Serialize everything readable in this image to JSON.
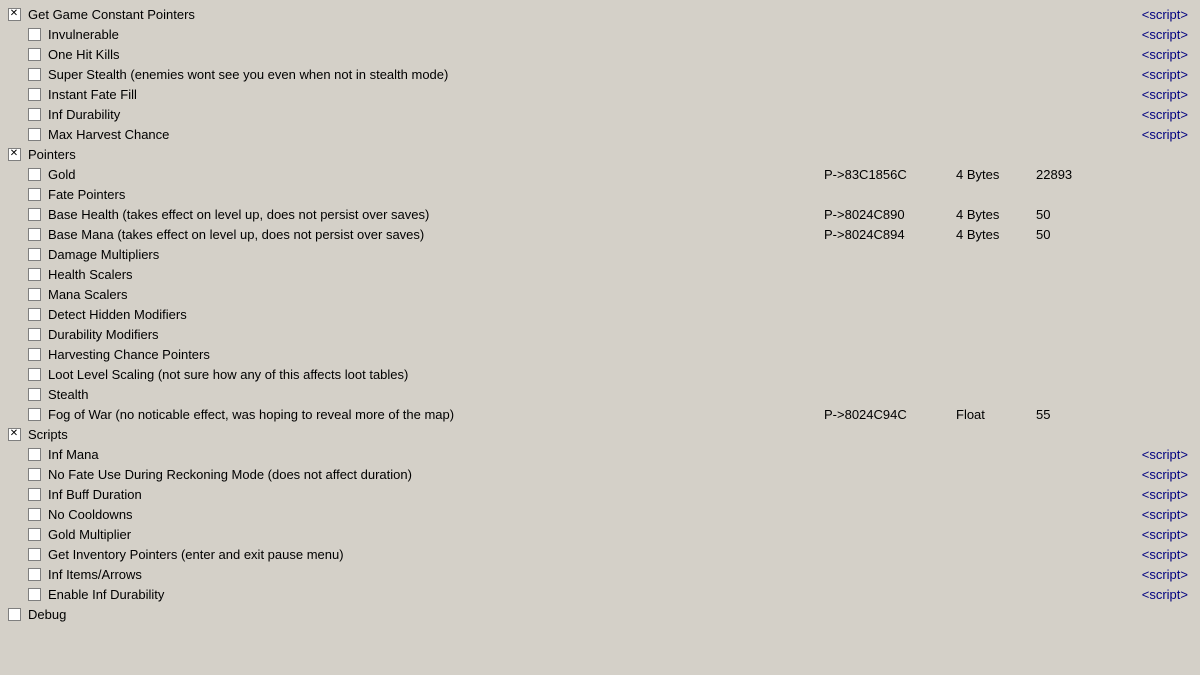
{
  "rows": [
    {
      "id": "get-game-constant-pointers",
      "indent": 1,
      "checkState": "x",
      "label": "Get Game Constant Pointers",
      "addr": "",
      "type": "",
      "value": "",
      "script": "<script>"
    },
    {
      "id": "invulnerable",
      "indent": 2,
      "checkState": "empty",
      "label": "Invulnerable",
      "addr": "",
      "type": "",
      "value": "",
      "script": "<script>"
    },
    {
      "id": "one-hit-kills",
      "indent": 2,
      "checkState": "empty",
      "label": "One Hit Kills",
      "addr": "",
      "type": "",
      "value": "",
      "script": "<script>"
    },
    {
      "id": "super-stealth",
      "indent": 2,
      "checkState": "empty",
      "label": "Super Stealth (enemies wont see you even when not in stealth mode)",
      "addr": "",
      "type": "",
      "value": "",
      "script": "<script>"
    },
    {
      "id": "instant-fate-fill",
      "indent": 2,
      "checkState": "empty",
      "label": "Instant Fate Fill",
      "addr": "",
      "type": "",
      "value": "",
      "script": "<script>"
    },
    {
      "id": "inf-durability",
      "indent": 2,
      "checkState": "empty",
      "label": "Inf Durability",
      "addr": "",
      "type": "",
      "value": "",
      "script": "<script>"
    },
    {
      "id": "max-harvest-chance",
      "indent": 2,
      "checkState": "empty",
      "label": "Max Harvest Chance",
      "addr": "",
      "type": "",
      "value": "",
      "script": "<script>"
    },
    {
      "id": "pointers",
      "indent": 1,
      "checkState": "x",
      "label": "Pointers",
      "addr": "",
      "type": "",
      "value": "",
      "script": ""
    },
    {
      "id": "gold",
      "indent": 2,
      "checkState": "empty",
      "label": "Gold",
      "addr": "P->83C1856C",
      "type": "4 Bytes",
      "value": "22893",
      "script": ""
    },
    {
      "id": "fate-pointers",
      "indent": 2,
      "checkState": "empty",
      "label": "Fate Pointers",
      "addr": "",
      "type": "",
      "value": "",
      "script": ""
    },
    {
      "id": "base-health",
      "indent": 2,
      "checkState": "empty",
      "label": "Base Health (takes effect on level up, does not persist over saves)",
      "addr": "P->8024C890",
      "type": "4 Bytes",
      "value": "50",
      "script": ""
    },
    {
      "id": "base-mana",
      "indent": 2,
      "checkState": "empty",
      "label": "Base Mana (takes effect on level up, does not persist over saves)",
      "addr": "P->8024C894",
      "type": "4 Bytes",
      "value": "50",
      "script": ""
    },
    {
      "id": "damage-multipliers",
      "indent": 2,
      "checkState": "empty",
      "label": "Damage Multipliers",
      "addr": "",
      "type": "",
      "value": "",
      "script": ""
    },
    {
      "id": "health-scalers",
      "indent": 2,
      "checkState": "empty",
      "label": "Health Scalers",
      "addr": "",
      "type": "",
      "value": "",
      "script": ""
    },
    {
      "id": "mana-scalers",
      "indent": 2,
      "checkState": "empty",
      "label": "Mana Scalers",
      "addr": "",
      "type": "",
      "value": "",
      "script": ""
    },
    {
      "id": "detect-hidden-modifiers",
      "indent": 2,
      "checkState": "empty",
      "label": "Detect Hidden Modifiers",
      "addr": "",
      "type": "",
      "value": "",
      "script": ""
    },
    {
      "id": "durability-modifiers",
      "indent": 2,
      "checkState": "empty",
      "label": "Durability Modifiers",
      "addr": "",
      "type": "",
      "value": "",
      "script": ""
    },
    {
      "id": "harvesting-chance-pointers",
      "indent": 2,
      "checkState": "empty",
      "label": "Harvesting Chance Pointers",
      "addr": "",
      "type": "",
      "value": "",
      "script": ""
    },
    {
      "id": "loot-level-scaling",
      "indent": 2,
      "checkState": "empty",
      "label": "Loot Level Scaling (not sure how any of this affects loot tables)",
      "addr": "",
      "type": "",
      "value": "",
      "script": ""
    },
    {
      "id": "stealth",
      "indent": 2,
      "checkState": "empty",
      "label": "Stealth",
      "addr": "",
      "type": "",
      "value": "",
      "script": ""
    },
    {
      "id": "fog-of-war",
      "indent": 2,
      "checkState": "empty",
      "label": "Fog of War (no noticable effect, was hoping to reveal more of the map)",
      "addr": "P->8024C94C",
      "type": "Float",
      "value": "55",
      "script": ""
    },
    {
      "id": "scripts",
      "indent": 1,
      "checkState": "x",
      "label": "Scripts",
      "addr": "",
      "type": "",
      "value": "",
      "script": ""
    },
    {
      "id": "inf-mana",
      "indent": 2,
      "checkState": "empty",
      "label": "Inf Mana",
      "addr": "",
      "type": "",
      "value": "",
      "script": "<script>"
    },
    {
      "id": "no-fate-use",
      "indent": 2,
      "checkState": "empty",
      "label": "No Fate Use During Reckoning Mode (does not affect duration)",
      "addr": "",
      "type": "",
      "value": "",
      "script": "<script>"
    },
    {
      "id": "inf-buff-duration",
      "indent": 2,
      "checkState": "empty",
      "label": "Inf Buff Duration",
      "addr": "",
      "type": "",
      "value": "",
      "script": "<script>"
    },
    {
      "id": "no-cooldowns",
      "indent": 2,
      "checkState": "empty",
      "label": "No Cooldowns",
      "addr": "",
      "type": "",
      "value": "",
      "script": "<script>"
    },
    {
      "id": "gold-multiplier",
      "indent": 2,
      "checkState": "empty",
      "label": "Gold Multiplier",
      "addr": "",
      "type": "",
      "value": "",
      "script": "<script>"
    },
    {
      "id": "get-inventory-pointers",
      "indent": 2,
      "checkState": "empty",
      "label": "Get Inventory Pointers (enter and exit pause menu)",
      "addr": "",
      "type": "",
      "value": "",
      "script": "<script>"
    },
    {
      "id": "inf-items-arrows",
      "indent": 2,
      "checkState": "empty",
      "label": "Inf Items/Arrows",
      "addr": "",
      "type": "",
      "value": "",
      "script": "<script>"
    },
    {
      "id": "enable-inf-durability",
      "indent": 2,
      "checkState": "empty",
      "label": "Enable Inf Durability",
      "addr": "",
      "type": "",
      "value": "",
      "script": "<script>"
    },
    {
      "id": "debug",
      "indent": 1,
      "checkState": "empty",
      "label": "Debug",
      "addr": "",
      "type": "",
      "value": "",
      "script": ""
    }
  ]
}
